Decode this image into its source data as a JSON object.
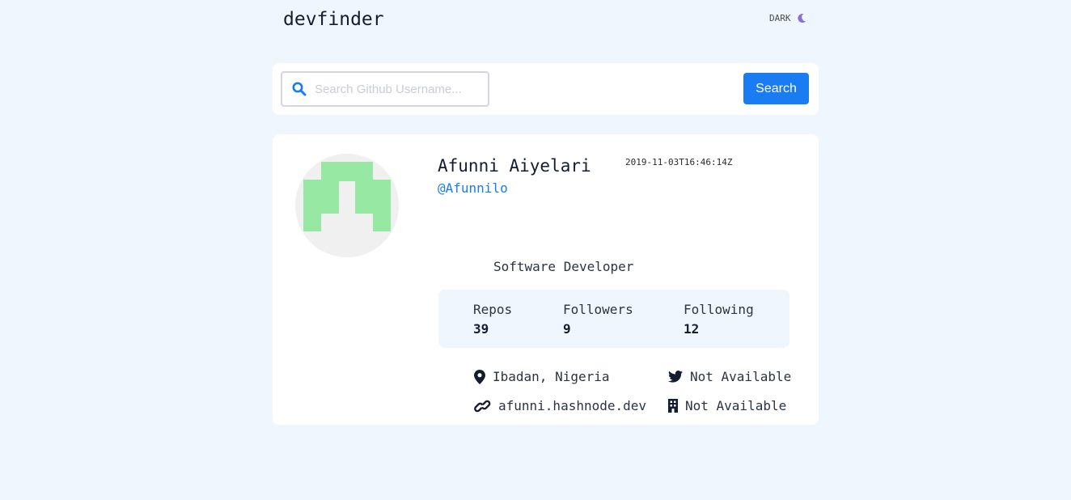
{
  "header": {
    "logo": "devfinder",
    "theme_label": "DARK",
    "theme_icon": "moon-icon"
  },
  "search": {
    "icon": "search-icon",
    "placeholder": "Search Github Username...",
    "value": "",
    "button_label": "Search"
  },
  "profile": {
    "avatar": "identicon-avatar",
    "name": "Afunni Aiyelari",
    "login": "@Afunnilo",
    "joined": "2019-11-03T16:46:14Z",
    "bio": "Software Developer",
    "stats": [
      {
        "label": "Repos",
        "value": "39"
      },
      {
        "label": "Followers",
        "value": "9"
      },
      {
        "label": "Following",
        "value": "12"
      }
    ],
    "links": {
      "location": {
        "icon": "location-pin-icon",
        "text": "Ibadan, Nigeria"
      },
      "twitter": {
        "icon": "twitter-icon",
        "text": "Not Available"
      },
      "website": {
        "icon": "link-icon",
        "text": "afunni.hashnode.dev"
      },
      "company": {
        "icon": "building-icon",
        "text": "Not Available"
      }
    }
  },
  "colors": {
    "background": "#eff6fe",
    "card": "#ffffff",
    "accent": "#1a7cf2",
    "moon": "#8a6fd6",
    "avatar_fill": "#97e8a2",
    "text_dark": "#141d2f"
  }
}
